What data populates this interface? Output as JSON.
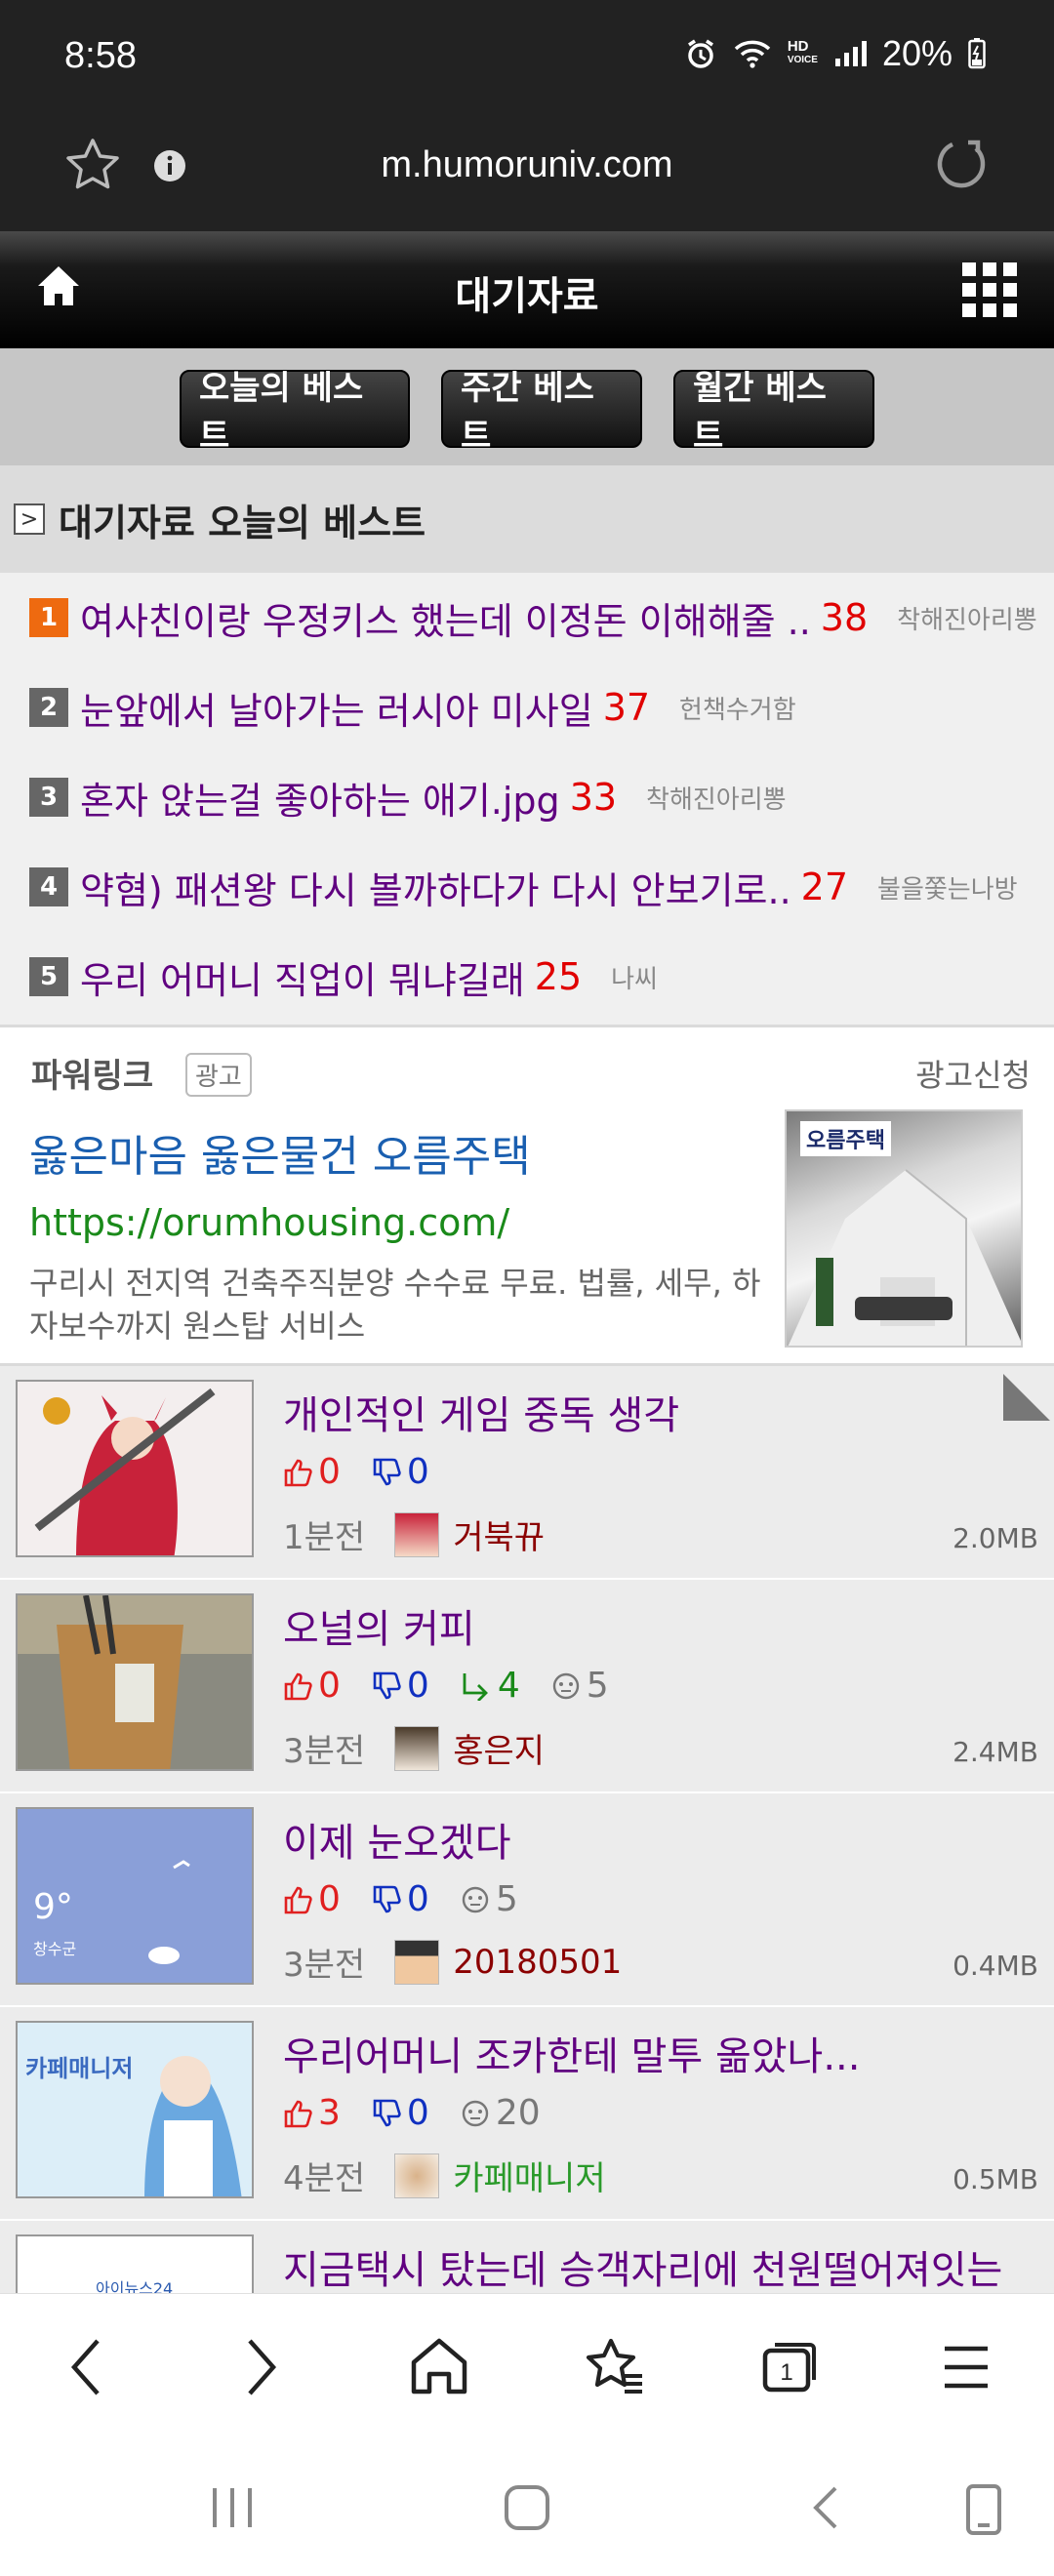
{
  "status_bar": {
    "time": "8:58",
    "hd_label": "HD",
    "voice_label": "VOICE",
    "battery": "20%"
  },
  "browser": {
    "url": "m.humoruniv.com"
  },
  "site_header": {
    "title": "대기자료"
  },
  "tabs": [
    {
      "label": "오늘의 베스트"
    },
    {
      "label": "주간 베스트"
    },
    {
      "label": "월간 베스트"
    }
  ],
  "best_section": {
    "title": "대기자료 오늘의 베스트"
  },
  "best_list": [
    {
      "rank": "1",
      "title": "여사친이랑 우정키스 했는데 이정돈 이해해줄 ..",
      "count": "38",
      "author": "착해진아리뽕"
    },
    {
      "rank": "2",
      "title": "눈앞에서 날아가는 러시아 미사일",
      "count": "37",
      "author": "헌책수거함"
    },
    {
      "rank": "3",
      "title": "혼자 앉는걸 좋아하는 애기.jpg",
      "count": "33",
      "author": "착해진아리뽕"
    },
    {
      "rank": "4",
      "title": "약혐) 패션왕 다시 볼까하다가 다시 안보기로..",
      "count": "27",
      "author": "불을쫓는나방"
    },
    {
      "rank": "5",
      "title": "우리 어머니 직업이 뭐냐길래",
      "count": "25",
      "author": "나씨"
    }
  ],
  "ad": {
    "label": "파워링크",
    "badge": "광고",
    "apply": "광고신청",
    "headline": "옳은마음 옳은물건 오름주택",
    "link": "https://orumhousing.com/",
    "description": "구리시 전지역 건축주직분양 수수료 무료. 법률, 세무, 하자보수까지 원스탑 서비스",
    "brand": "오름주택"
  },
  "feed": [
    {
      "title": "개인적인 게임 중독 생각",
      "up": "0",
      "down": "0",
      "reply": "",
      "comments": "",
      "time": "1분전",
      "author": "거북뀨",
      "size": "2.0MB"
    },
    {
      "title": "오널의 커피",
      "up": "0",
      "down": "0",
      "reply": "4",
      "comments": "5",
      "time": "3분전",
      "author": "홍은지",
      "size": "2.4MB"
    },
    {
      "title": "이제 눈오겠다",
      "up": "0",
      "down": "0",
      "reply": "",
      "comments": "5",
      "time": "3분전",
      "author": "20180501",
      "size": "0.4MB",
      "thumb_temp": "9°",
      "thumb_place": "창수군"
    },
    {
      "title": "우리어머니 조카한테 말투 옮았나...",
      "up": "3",
      "down": "0",
      "reply": "",
      "comments": "20",
      "time": "4분전",
      "author": "카페매니저",
      "size": "0.5MB",
      "thumb_text": "카페매니저"
    },
    {
      "title": "지금택시 탔는데 승객자리에 천원떨어져잇는",
      "thumb_text": "아이뉴스24"
    }
  ],
  "colors": {
    "accent_orange": "#ee6a10",
    "title_purple": "#600080",
    "count_red": "#e00000",
    "link_green": "#1a8a1a",
    "headline_blue": "#1a5fb0"
  }
}
